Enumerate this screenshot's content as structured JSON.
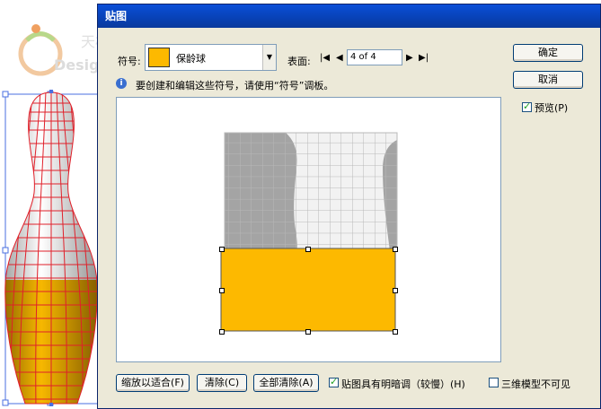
{
  "watermark": {
    "line1": "天极设计在线",
    "line2": "Design.yesky.com"
  },
  "dialog": {
    "title": "贴图",
    "symbol_label": "符号:",
    "symbol_value": "保龄球",
    "surface_label": "表面:",
    "surface_value": "4 of 4",
    "info_text": "要创建和编辑这些符号，请使用“符号”调板。",
    "ok_button": "确定",
    "cancel_button": "取消",
    "preview_label": "预览(P)",
    "preview_checked": true,
    "shrink_to_fit_button": "缩放以适合(F)",
    "clear_button": "清除(C)",
    "clear_all_button": "全部清除(A)",
    "shade_artwork_label": "贴图具有明暗调（较慢）(H)",
    "shade_artwork_checked": true,
    "invisible_geometry_label": "三维模型不可见",
    "invisible_geometry_checked": false
  },
  "colors": {
    "symbol_fill": "#fdb900",
    "mesh_line": "#e0202a",
    "pin_white": "#e8e8e8",
    "dialog_bg": "#ece9d8"
  }
}
